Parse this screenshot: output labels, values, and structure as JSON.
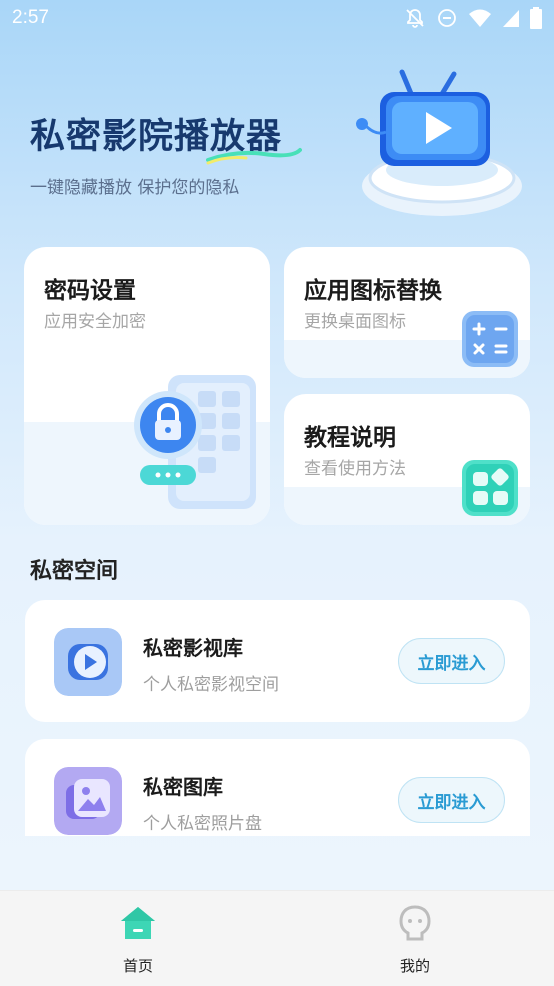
{
  "status_bar": {
    "time": "2:57"
  },
  "hero": {
    "title": "私密影院播放器",
    "subtitle": "一键隐藏播放 保护您的隐私"
  },
  "cards": {
    "password": {
      "title": "密码设置",
      "subtitle": "应用安全加密"
    },
    "icon_swap": {
      "title": "应用图标替换",
      "subtitle": "更换桌面图标"
    },
    "tutorial": {
      "title": "教程说明",
      "subtitle": "查看使用方法"
    }
  },
  "private_space": {
    "title": "私密空间",
    "items": [
      {
        "title": "私密影视库",
        "subtitle": "个人私密影视空间",
        "button": "立即进入"
      },
      {
        "title": "私密图库",
        "subtitle": "个人私密照片盘",
        "button": "立即进入"
      }
    ]
  },
  "bottom_nav": {
    "items": [
      {
        "label": "首页",
        "active": true
      },
      {
        "label": "我的",
        "active": false
      }
    ]
  },
  "colors": {
    "accent": "#2a9bd3",
    "home_active": "#3dd6b5",
    "title_dark": "#17396e"
  }
}
